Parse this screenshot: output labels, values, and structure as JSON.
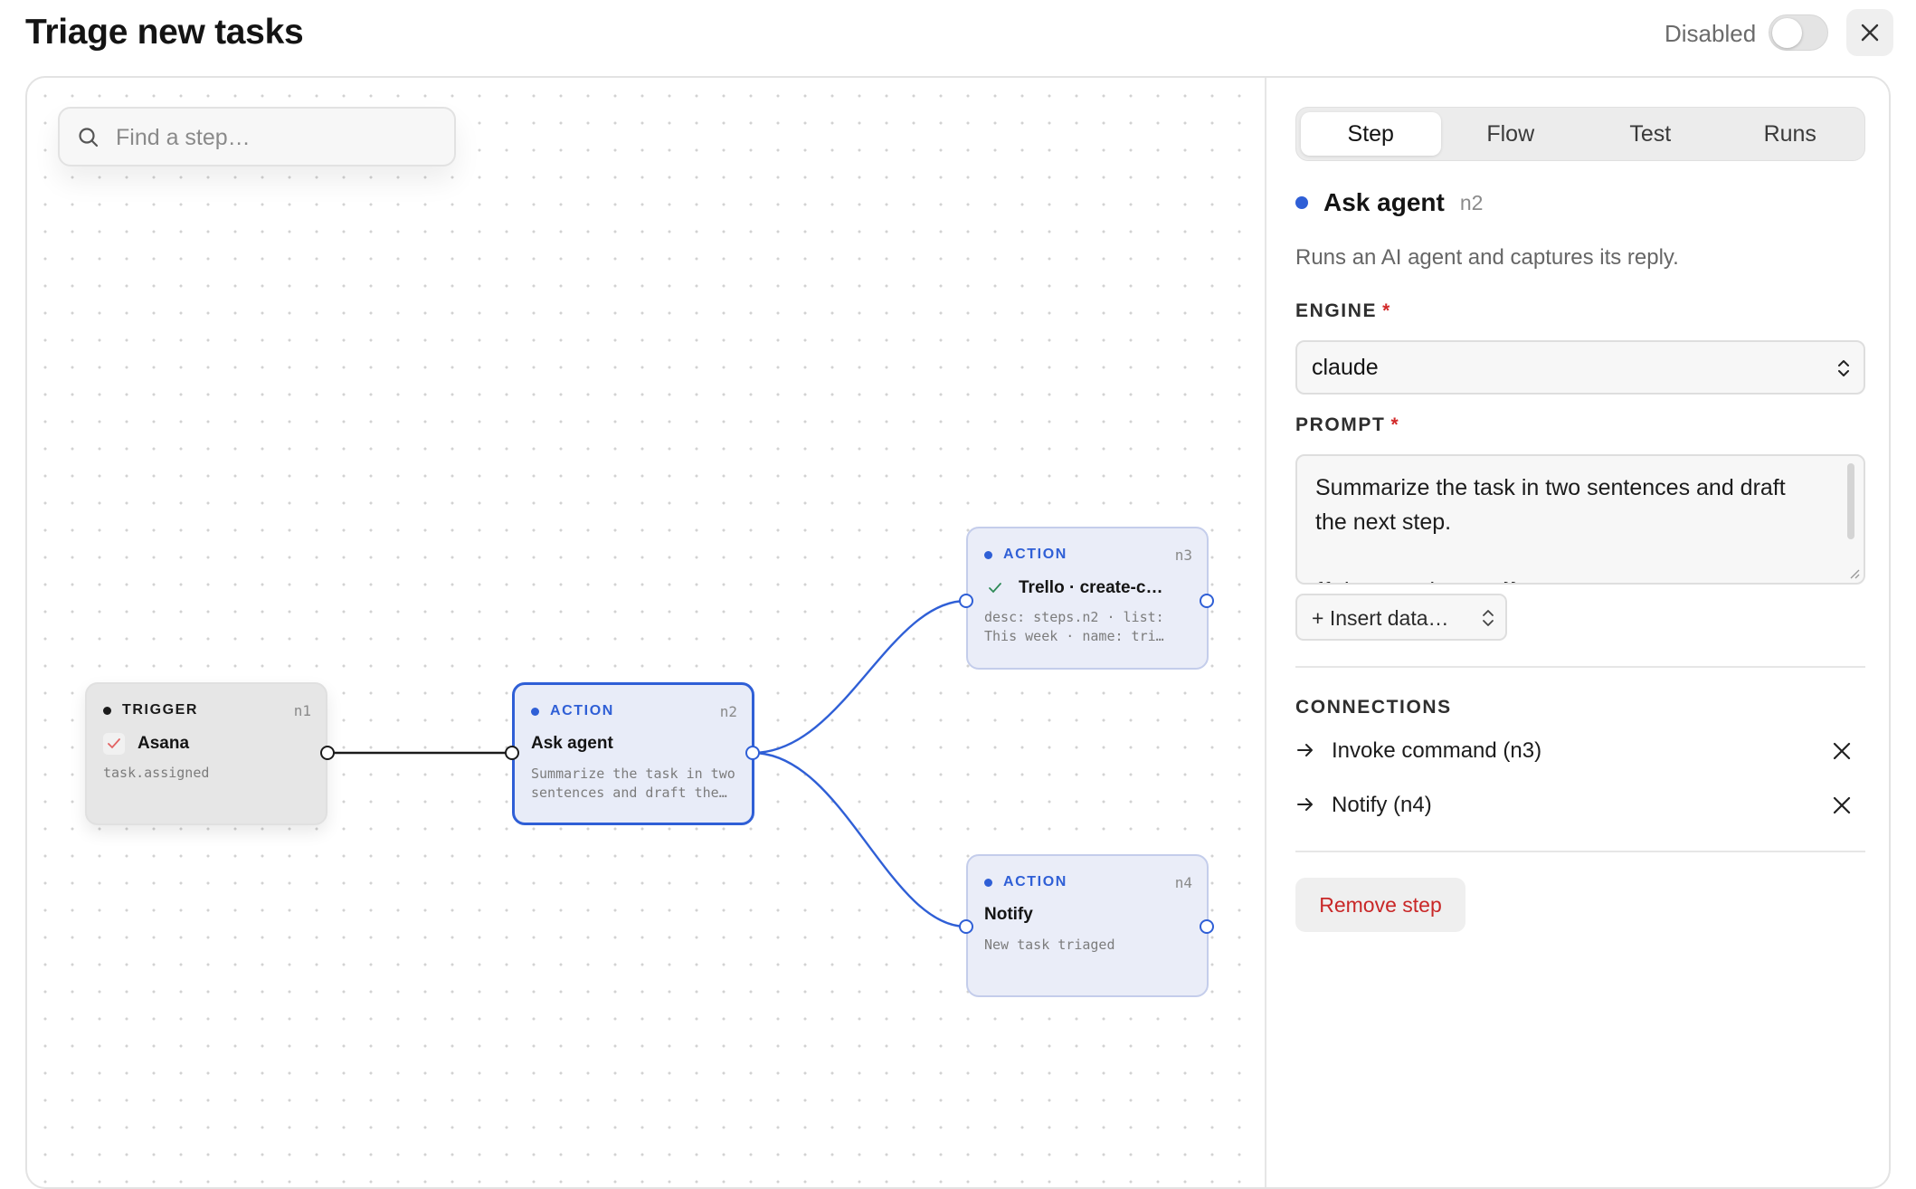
{
  "header": {
    "title": "Triage new tasks",
    "status_label": "Disabled",
    "toggle_on": false,
    "close_icon": "close-icon"
  },
  "canvas": {
    "search_placeholder": "Find a step…",
    "nodes": [
      {
        "id": "n1",
        "kind": "TRIGGER",
        "name": "Asana",
        "icon": "asana-check-icon",
        "desc": "task.assigned"
      },
      {
        "id": "n2",
        "kind": "ACTION",
        "name": "Ask agent",
        "desc": "Summarize the task in two sentences and draft the next step.",
        "selected": true
      },
      {
        "id": "n3",
        "kind": "ACTION",
        "name": "Trello · create-c…",
        "icon": "check-icon",
        "desc": "desc: steps.n2 · list: This week · name: tri…"
      },
      {
        "id": "n4",
        "kind": "ACTION",
        "name": "Notify",
        "desc": "New task triaged"
      }
    ]
  },
  "panel": {
    "tabs": [
      "Step",
      "Flow",
      "Test",
      "Runs"
    ],
    "active_tab": "Step",
    "step": {
      "name": "Ask agent",
      "id": "n2",
      "subtitle": "Runs an AI agent and captures its reply."
    },
    "engine": {
      "label": "ENGINE",
      "required": "*",
      "value": "claude"
    },
    "prompt": {
      "label": "PROMPT",
      "required": "*",
      "value": "Summarize the task in two sentences and draft the next step.\n\n{{trigger.task.name}}"
    },
    "insert_data_label": "+ Insert data…",
    "connections": {
      "label": "CONNECTIONS",
      "items": [
        {
          "label": "Invoke command (n3)"
        },
        {
          "label": "Notify (n4)"
        }
      ]
    },
    "remove_label": "Remove step"
  },
  "colors": {
    "accent": "#2f5fd6",
    "danger": "#c92727",
    "required": "#d22a2a"
  }
}
